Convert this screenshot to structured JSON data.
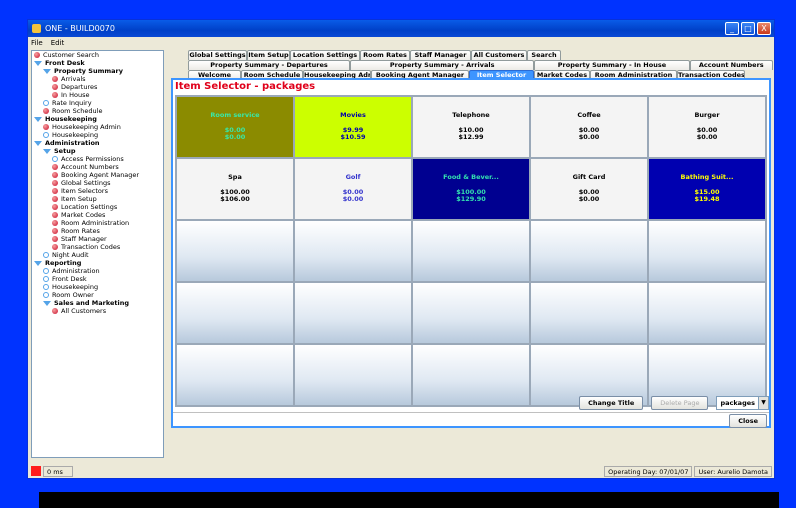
{
  "window": {
    "title": "ONE - BUILD0070",
    "minimize": "_",
    "maximize": "□",
    "close": "X"
  },
  "menu": [
    "File",
    "Edit"
  ],
  "sidebar": {
    "items": [
      {
        "label": "Customer Search",
        "type": "red",
        "indent": 0,
        "bold": false
      },
      {
        "label": "Front Desk",
        "type": "tri",
        "indent": 0,
        "bold": true
      },
      {
        "label": "Property Summary",
        "type": "tri",
        "indent": 1,
        "bold": true
      },
      {
        "label": "Arrivals",
        "type": "red",
        "indent": 2,
        "bold": false
      },
      {
        "label": "Departures",
        "type": "red",
        "indent": 2,
        "bold": false
      },
      {
        "label": "In House",
        "type": "red",
        "indent": 2,
        "bold": false
      },
      {
        "label": "Rate Inquiry",
        "type": "blue",
        "indent": 1,
        "bold": false
      },
      {
        "label": "Room Schedule",
        "type": "red",
        "indent": 1,
        "bold": false
      },
      {
        "label": "Housekeeping",
        "type": "tri",
        "indent": 0,
        "bold": true
      },
      {
        "label": "Housekeeping Admin",
        "type": "red",
        "indent": 1,
        "bold": false
      },
      {
        "label": "Housekeeping",
        "type": "blue",
        "indent": 1,
        "bold": false
      },
      {
        "label": "Administration",
        "type": "tri",
        "indent": 0,
        "bold": true
      },
      {
        "label": "Setup",
        "type": "tri",
        "indent": 1,
        "bold": true
      },
      {
        "label": "Access Permissions",
        "type": "blue",
        "indent": 2,
        "bold": false
      },
      {
        "label": "Account Numbers",
        "type": "red",
        "indent": 2,
        "bold": false
      },
      {
        "label": "Booking Agent Manager",
        "type": "red",
        "indent": 2,
        "bold": false
      },
      {
        "label": "Global Settings",
        "type": "red",
        "indent": 2,
        "bold": false
      },
      {
        "label": "Item Selectors",
        "type": "red",
        "indent": 2,
        "bold": false
      },
      {
        "label": "Item Setup",
        "type": "red",
        "indent": 2,
        "bold": false
      },
      {
        "label": "Location Settings",
        "type": "red",
        "indent": 2,
        "bold": false
      },
      {
        "label": "Market Codes",
        "type": "red",
        "indent": 2,
        "bold": false
      },
      {
        "label": "Room Administration",
        "type": "red",
        "indent": 2,
        "bold": false
      },
      {
        "label": "Room Rates",
        "type": "red",
        "indent": 2,
        "bold": false
      },
      {
        "label": "Staff Manager",
        "type": "red",
        "indent": 2,
        "bold": false
      },
      {
        "label": "Transaction Codes",
        "type": "red",
        "indent": 2,
        "bold": false
      },
      {
        "label": "Night Audit",
        "type": "blue",
        "indent": 1,
        "bold": false
      },
      {
        "label": "Reporting",
        "type": "tri",
        "indent": 0,
        "bold": true
      },
      {
        "label": "Administration",
        "type": "blue",
        "indent": 1,
        "bold": false
      },
      {
        "label": "Front Desk",
        "type": "blue",
        "indent": 1,
        "bold": false
      },
      {
        "label": "Housekeeping",
        "type": "blue",
        "indent": 1,
        "bold": false
      },
      {
        "label": "Room Owner",
        "type": "blue",
        "indent": 1,
        "bold": false
      },
      {
        "label": "Sales and Marketing",
        "type": "tri",
        "indent": 1,
        "bold": true
      },
      {
        "label": "All Customers",
        "type": "red",
        "indent": 2,
        "bold": false
      }
    ]
  },
  "tabs": {
    "row1": [
      "Global Settings",
      "Item Setup",
      "Location Settings",
      "Room Rates",
      "Staff Manager",
      "All Customers",
      "Search"
    ],
    "row2": [
      "Property Summary - Departures",
      "Property Summary - Arrivals",
      "Property Summary - In House",
      "Account Numbers"
    ],
    "row3": [
      "Welcome",
      "Room Schedule",
      "Housekeeping Admin",
      "Booking Agent Manager",
      "Item Selector",
      "Market Codes",
      "Room Administration",
      "Transaction Codes"
    ],
    "active": "Item Selector"
  },
  "panel": {
    "title": "Item Selector - packages"
  },
  "items": [
    {
      "name": "Room service",
      "v1": "$0.00",
      "v2": "$0.00",
      "bg": "#8b8b00",
      "fg": "#38e8a8"
    },
    {
      "name": "Movies",
      "v1": "$9.99",
      "v2": "$10.59",
      "bg": "#ccff00",
      "fg": "#0000aa"
    },
    {
      "name": "Telephone",
      "v1": "$10.00",
      "v2": "$12.99",
      "bg": "#f4f4f4",
      "fg": "#000000"
    },
    {
      "name": "Coffee",
      "v1": "$0.00",
      "v2": "$0.00",
      "bg": "#f4f4f4",
      "fg": "#000000"
    },
    {
      "name": "Burger",
      "v1": "$0.00",
      "v2": "$0.00",
      "bg": "#f4f4f4",
      "fg": "#000000"
    },
    {
      "name": "Spa",
      "v1": "$100.00",
      "v2": "$106.00",
      "bg": "#f4f4f4",
      "fg": "#000000"
    },
    {
      "name": "Golf",
      "v1": "$0.00",
      "v2": "$0.00",
      "bg": "#f4f4f4",
      "fg": "#3333cc"
    },
    {
      "name": "Food & Bever...",
      "v1": "$100.00",
      "v2": "$129.90",
      "bg": "#000090",
      "fg": "#33e0b0"
    },
    {
      "name": "Gift Card",
      "v1": "$0.00",
      "v2": "$0.00",
      "bg": "#f4f4f4",
      "fg": "#000000"
    },
    {
      "name": "Bathing Suit...",
      "v1": "$15.00",
      "v2": "$19.48",
      "bg": "#0000b0",
      "fg": "#ffff00"
    }
  ],
  "empty_cells": 15,
  "buttons": {
    "change_title": "Change Title",
    "delete_page": "Delete Page",
    "page_select": "packages",
    "close": "Close"
  },
  "status": {
    "ms": "0 ms",
    "operating_day": "Operating Day: 07/01/07",
    "user": "User: Aurelio Damota"
  }
}
